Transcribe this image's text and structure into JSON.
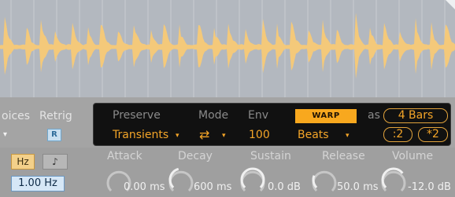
{
  "colors": {
    "waveform_fill": "#f4c97a",
    "waveform_bg": "#b3b8bf",
    "warp_accent": "#f8a81e",
    "panel_bg": "#111111"
  },
  "voice_section": {
    "voices_label": "oices",
    "retrig_label": "Retrig",
    "retrig_button": "R",
    "voices_arrow": "▾",
    "hz_button": "Hz",
    "note_icon": "♪",
    "frequency_value": "1.00 Hz"
  },
  "envelope": {
    "attack_label": "Attack",
    "attack_value": "0.00 ms",
    "attack_level": 0.0,
    "decay_label": "Decay",
    "decay_value": "600 ms",
    "decay_level": 0.45,
    "sustain_label": "Sustain",
    "sustain_value": "0.0 dB",
    "sustain_level": 1.0,
    "release_label": "Release",
    "release_value": "50.0 ms",
    "release_level": 0.25,
    "volume_label": "Volume",
    "volume_value": "-12.0 dB",
    "volume_level": 0.7
  },
  "warp_panel": {
    "preserve_label": "Preserve",
    "preserve_value": "Transients",
    "mode_label": "Mode",
    "mode_icon": "loop-arrows-icon",
    "mode_glyph": "⇄",
    "env_label": "Env",
    "env_value": "100",
    "warp_button": "WARP",
    "warp_mode_value": "Beats",
    "as_label": "as",
    "length_value": "4 Bars",
    "halve_button": ":2",
    "double_button": "*2",
    "dropdown_arrow": "▾"
  }
}
